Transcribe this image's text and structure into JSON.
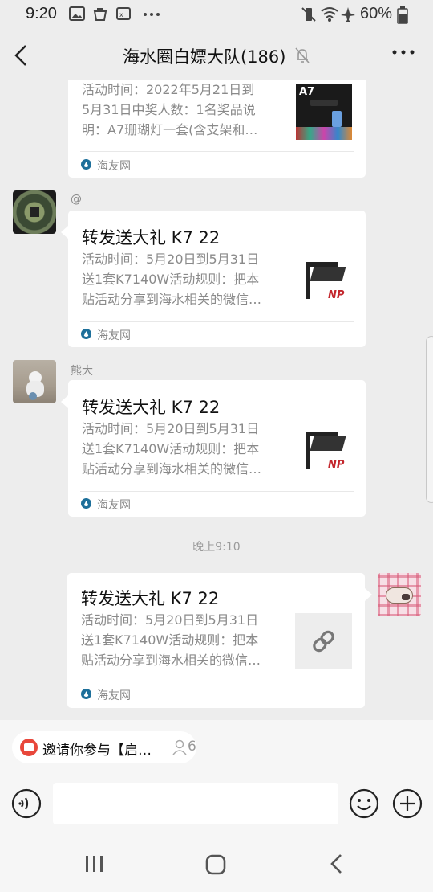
{
  "status_bar": {
    "time": "9:20",
    "battery": "60%",
    "left_icons": [
      "image-icon",
      "bag-icon",
      "sim-icon",
      "more-dots-icon"
    ],
    "right_icons": [
      "vibrate-mute-icon",
      "wifi-icon",
      "airplane-icon",
      "battery-icon"
    ]
  },
  "header": {
    "title": "海水圈白嫖大队(186)",
    "muted": true
  },
  "messages": [
    {
      "sender": "",
      "side": "left",
      "title": "",
      "desc_lines": [
        "活动时间：2022年5月21日到",
        "5月31日中奖人数：1名奖品说",
        "明：A7珊瑚灯一套(含支架和…"
      ],
      "thumb_label": "A7",
      "source": "海友网"
    },
    {
      "sender": "@",
      "side": "left",
      "title": "转发送大礼 K7 22",
      "desc_lines": [
        "活动时间：5月20日到5月31日",
        "送1套K7140W活动规则：把本",
        "贴活动分享到海水相关的微信…"
      ],
      "thumb_label": "NP",
      "source": "海友网"
    },
    {
      "sender": "熊大",
      "side": "left",
      "title": "转发送大礼 K7 22",
      "desc_lines": [
        "活动时间：5月20日到5月31日",
        "送1套K7140W活动规则：把本",
        "贴活动分享到海水相关的微信…"
      ],
      "thumb_label": "NP",
      "source": "海友网"
    },
    {
      "sender": "",
      "side": "right",
      "title": "转发送大礼 K7 22",
      "desc_lines": [
        "活动时间：5月20日到5月31日",
        "送1套K7140W活动规则：把本",
        "贴活动分享到海水相关的微信…"
      ],
      "thumb_label": "",
      "source": "海友网"
    }
  ],
  "timestamp": "晚上9:10",
  "invite_chip": {
    "label": "邀请你参与【启…",
    "count": "6"
  },
  "input": {
    "placeholder": ""
  },
  "colors": {
    "background": "#ededed",
    "card": "#ffffff",
    "text_secondary": "#8a8a8a",
    "source_icon": "#1d6f9a",
    "chip_icon": "#e8473b"
  }
}
